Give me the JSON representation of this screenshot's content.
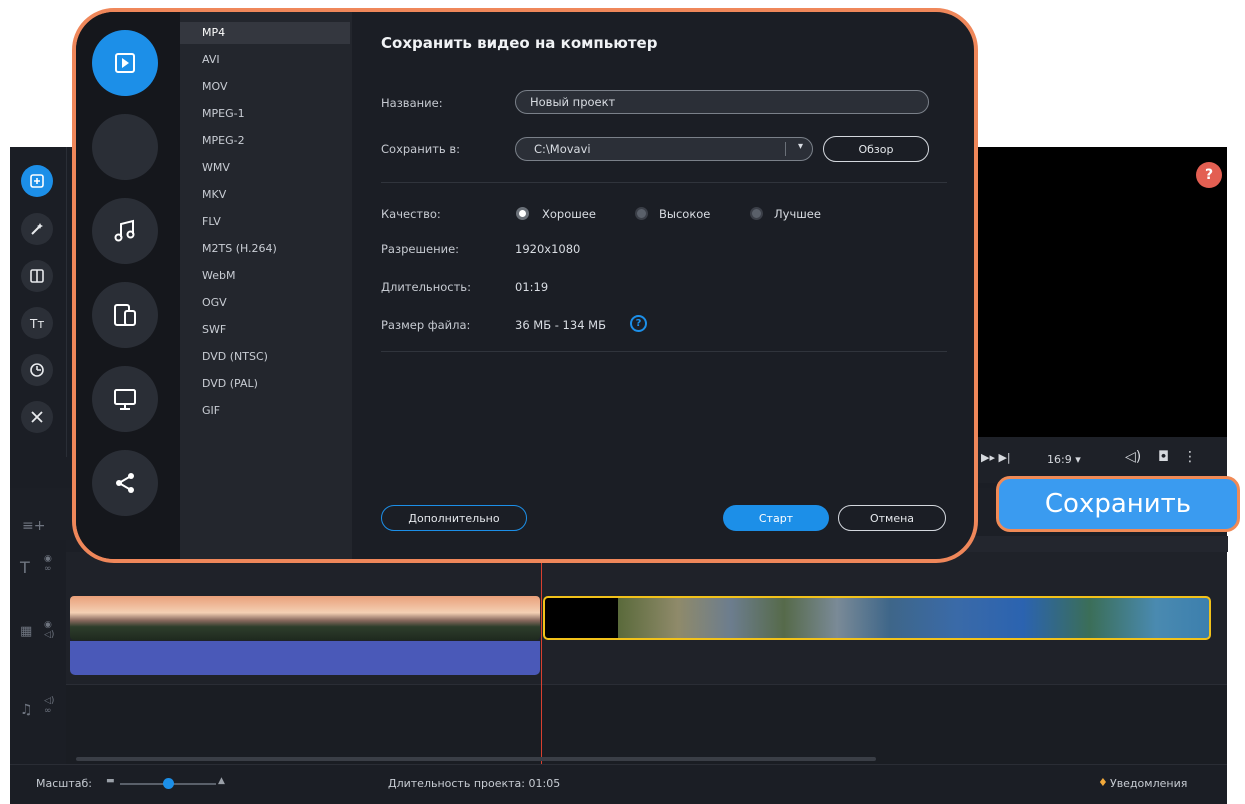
{
  "dialog": {
    "title": "Сохранить видео на компьютер",
    "categories": [
      {
        "name": "video-file",
        "icon": "play-icon",
        "active": true
      },
      {
        "name": "blank",
        "icon": "",
        "active": false
      },
      {
        "name": "audio",
        "icon": "music-note-icon",
        "active": false
      },
      {
        "name": "devices",
        "icon": "devices-icon",
        "active": false
      },
      {
        "name": "tv",
        "icon": "monitor-icon",
        "active": false
      },
      {
        "name": "share",
        "icon": "share-icon",
        "active": false
      }
    ],
    "formats": [
      "MP4",
      "AVI",
      "MOV",
      "MPEG-1",
      "MPEG-2",
      "WMV",
      "MKV",
      "FLV",
      "M2TS (H.264)",
      "WebM",
      "OGV",
      "SWF",
      "DVD (NTSC)",
      "DVD (PAL)",
      "GIF"
    ],
    "selected_format": "MP4",
    "name_label": "Название:",
    "name_value": "Новый проект",
    "save_to_label": "Сохранить в:",
    "save_to_value": "C:\\Movavi",
    "browse_button": "Обзор",
    "quality_label": "Качество:",
    "quality_options": [
      {
        "label": "Хорошее",
        "selected": true
      },
      {
        "label": "Высокое",
        "selected": false
      },
      {
        "label": "Лучшее",
        "selected": false
      }
    ],
    "resolution_label": "Разрешение:",
    "resolution_value": "1920x1080",
    "duration_label": "Длительность:",
    "duration_value": "01:19",
    "filesize_label": "Размер файла:",
    "filesize_value": "36 МБ - 134 МБ",
    "advanced_button": "Дополнительно",
    "start_button": "Старт",
    "cancel_button": "Отмена"
  },
  "editor": {
    "save_button": "Сохранить",
    "aspect_ratio": "16:9",
    "scale_label": "Масштаб:",
    "project_duration": "Длительность проекта: 01:05",
    "notifications": "Уведомления",
    "help_icon": "?"
  },
  "colors": {
    "accent": "#1c8fe8",
    "highlight_border": "#ef875a",
    "clip_selected_border": "#f2c21a",
    "playhead": "#d8402f",
    "audio_clip": "#4a59b8"
  }
}
